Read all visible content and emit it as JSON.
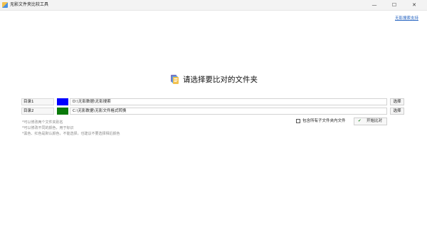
{
  "window": {
    "title": "无影文件夹比较工具",
    "minimize_glyph": "—",
    "maximize_glyph": "☐",
    "close_glyph": "✕"
  },
  "support_link": "无影搜索支持",
  "heading": "请选择要比对的文件夹",
  "rows": [
    {
      "label": "目录1",
      "color": "#0000ff",
      "path": "D:\\无影数据\\无影搜索",
      "button": "选择"
    },
    {
      "label": "目录2",
      "color": "#0a7a0a",
      "path": "C:\\无影数据\\无影文件格式转换",
      "button": "选择"
    }
  ],
  "hints": [
    "*可以修改两个文件夹别名",
    "*可以修改不同的颜色，用于标识",
    "*黑色、红色是默认颜色，不能选择，也建议不要选择相近颜色"
  ],
  "include_subfolders_label": "包含所有子文件夹内文件",
  "start_button": "开始比对"
}
